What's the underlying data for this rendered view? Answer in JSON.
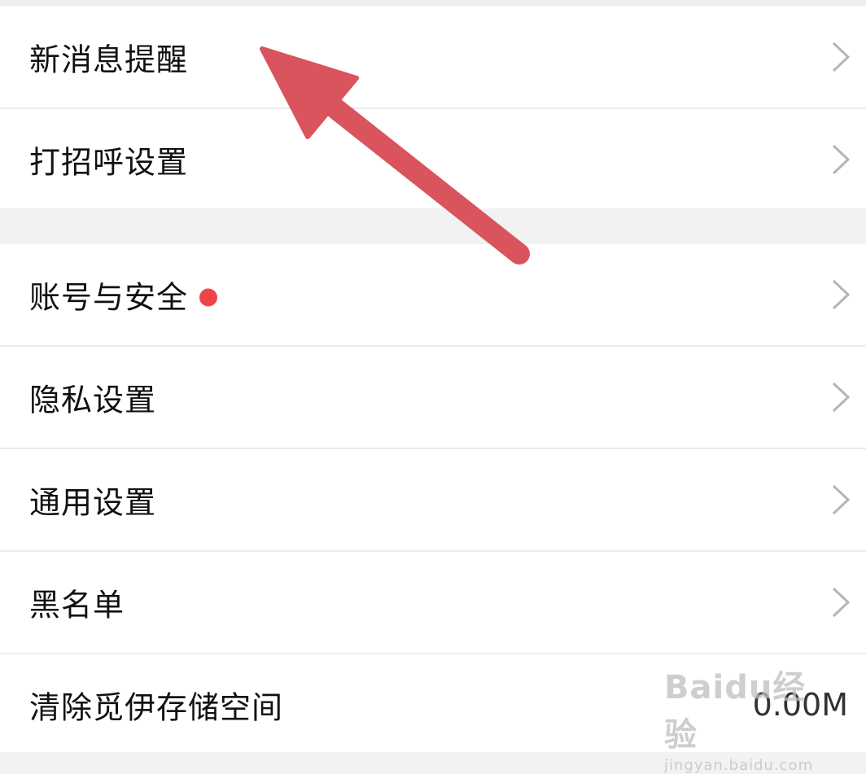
{
  "settings": {
    "group1": [
      {
        "label": "新消息提醒"
      },
      {
        "label": "打招呼设置"
      }
    ],
    "group2": [
      {
        "label": "账号与安全"
      },
      {
        "label": "隐私设置"
      },
      {
        "label": "通用设置"
      },
      {
        "label": "黑名单"
      },
      {
        "label": "清除觅伊存储空间",
        "value": "0.00M"
      }
    ]
  },
  "watermark": {
    "logo": "Baidu经验",
    "url": "jingyan.baidu.com"
  },
  "colors": {
    "arrow": "#d9545c",
    "badge": "#f0444b",
    "chevron": "#b5b5b5",
    "background": "#f2f2f2"
  },
  "icons": {
    "chevron": "chevron-right-icon",
    "badge": "red-dot-badge",
    "annotation": "arrow-annotation"
  }
}
